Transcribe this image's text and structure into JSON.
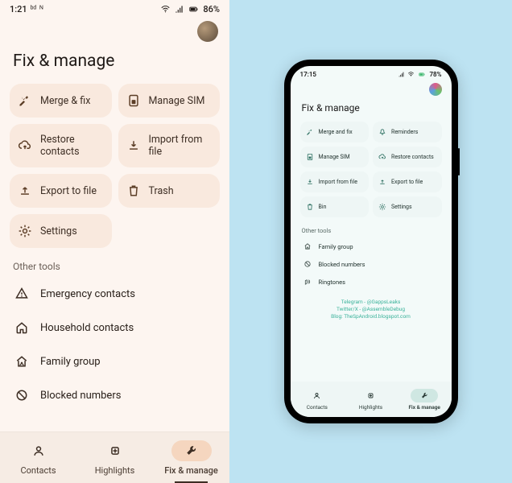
{
  "left": {
    "statusbar": {
      "time": "1:21",
      "battery": "86%"
    },
    "title": "Fix & manage",
    "cards": [
      {
        "label": "Merge & fix",
        "icon": "tools-icon"
      },
      {
        "label": "Manage SIM",
        "icon": "sim-icon"
      },
      {
        "label": "Restore contacts",
        "icon": "cloud-up-icon"
      },
      {
        "label": "Import from file",
        "icon": "download-icon"
      },
      {
        "label": "Export to file",
        "icon": "upload-icon"
      },
      {
        "label": "Trash",
        "icon": "trash-icon"
      },
      {
        "label": "Settings",
        "icon": "gear-icon"
      }
    ],
    "other_title": "Other tools",
    "tools": [
      {
        "label": "Emergency contacts",
        "icon": "emergency-icon"
      },
      {
        "label": "Household contacts",
        "icon": "home-icon"
      },
      {
        "label": "Family group",
        "icon": "family-icon"
      },
      {
        "label": "Blocked numbers",
        "icon": "block-icon"
      }
    ],
    "nav": [
      {
        "label": "Contacts",
        "icon": "person-icon",
        "active": false
      },
      {
        "label": "Highlights",
        "icon": "sparkle-icon",
        "active": false
      },
      {
        "label": "Fix & manage",
        "icon": "wrench-icon",
        "active": true
      }
    ]
  },
  "right": {
    "statusbar": {
      "time": "17:15",
      "battery": "78%"
    },
    "title": "Fix & manage",
    "cards": [
      {
        "label": "Merge and fix",
        "icon": "tools-icon"
      },
      {
        "label": "Reminders",
        "icon": "bell-icon"
      },
      {
        "label": "Manage SIM",
        "icon": "sim-icon"
      },
      {
        "label": "Restore contacts",
        "icon": "cloud-up-icon"
      },
      {
        "label": "Import from file",
        "icon": "download-icon"
      },
      {
        "label": "Export to file",
        "icon": "upload-icon"
      },
      {
        "label": "Bin",
        "icon": "trash-icon"
      },
      {
        "label": "Settings",
        "icon": "gear-icon"
      }
    ],
    "other_title": "Other tools",
    "tools": [
      {
        "label": "Family group",
        "icon": "family-icon"
      },
      {
        "label": "Blocked numbers",
        "icon": "block-icon"
      },
      {
        "label": "Ringtones",
        "icon": "ringtone-icon"
      }
    ],
    "credits": {
      "line1": "Telegram - @GappsLeaks",
      "line2": "Twitter/X - @AssembleDebug",
      "line3": "Blog: TheSpAndroid.blogspot.com"
    },
    "nav": [
      {
        "label": "Contacts",
        "icon": "person-icon",
        "active": false
      },
      {
        "label": "Highlights",
        "icon": "sparkle-icon",
        "active": false
      },
      {
        "label": "Fix & manage",
        "icon": "wrench-icon",
        "active": true
      }
    ]
  }
}
